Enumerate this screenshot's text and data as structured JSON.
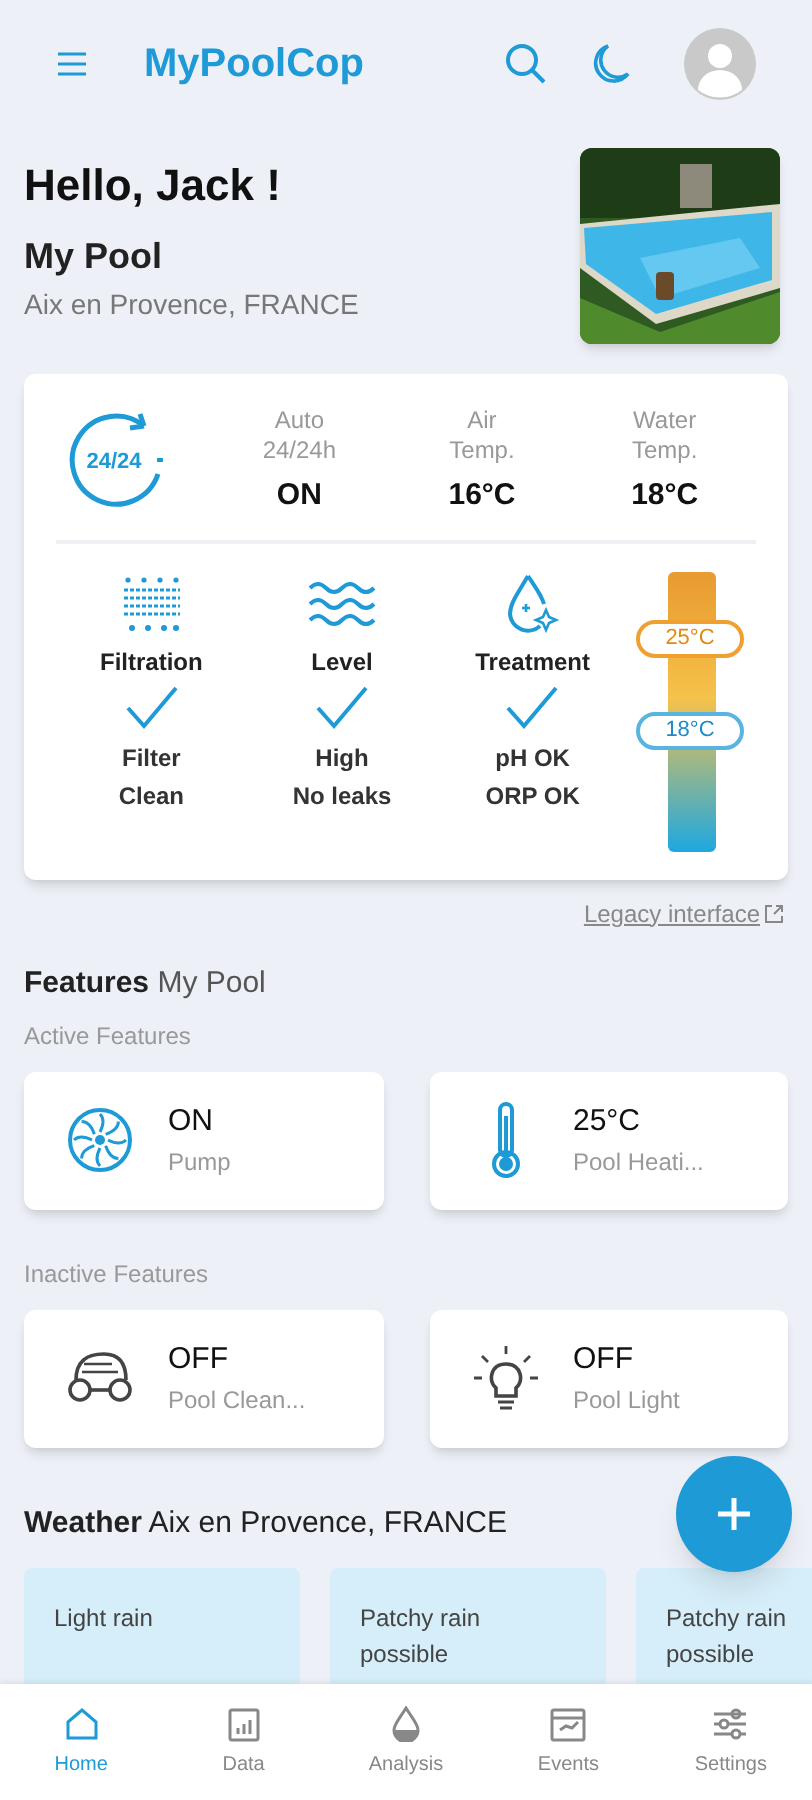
{
  "header": {
    "title": "MyPoolCop"
  },
  "greeting": "Hello, Jack !",
  "pool": {
    "name": "My Pool",
    "location": "Aix en Provence, FRANCE"
  },
  "summary": {
    "badge": "24/24",
    "stats": [
      {
        "label": "Auto\n24/24h",
        "value": "ON"
      },
      {
        "label": "Air\nTemp.",
        "value": "16°C"
      },
      {
        "label": "Water\nTemp.",
        "value": "18°C"
      }
    ],
    "checks": [
      {
        "kind": "filtration",
        "title": "Filtration",
        "checked": true,
        "status": "Filter\nClean"
      },
      {
        "kind": "level",
        "title": "Level",
        "checked": true,
        "status": "High\nNo leaks"
      },
      {
        "kind": "treatment",
        "title": "Treatment",
        "checked": true,
        "status": "pH OK\nORP OK"
      }
    ],
    "gauge": {
      "target": "25°C",
      "current": "18°C"
    }
  },
  "legacy_link": "Legacy interface",
  "features": {
    "title": "Features",
    "subtitle": "My Pool",
    "groups": [
      {
        "label": "Active Features",
        "items": [
          {
            "kind": "pump",
            "value": "ON",
            "name": "Pump"
          },
          {
            "kind": "heater",
            "value": "25°C",
            "name": "Pool Heati..."
          }
        ]
      },
      {
        "label": "Inactive Features",
        "items": [
          {
            "kind": "cleaner",
            "value": "OFF",
            "name": "Pool Clean..."
          },
          {
            "kind": "light",
            "value": "OFF",
            "name": "Pool Light"
          }
        ]
      }
    ]
  },
  "weather": {
    "title": "Weather",
    "location": "Aix en Provence, FRANCE",
    "cards": [
      "Light rain",
      "Patchy rain possible",
      "Patchy rain possible"
    ]
  },
  "nav": [
    {
      "kind": "home",
      "label": "Home",
      "selected": true
    },
    {
      "kind": "data",
      "label": "Data",
      "selected": false
    },
    {
      "kind": "analysis",
      "label": "Analysis",
      "selected": false
    },
    {
      "kind": "events",
      "label": "Events",
      "selected": false
    },
    {
      "kind": "settings",
      "label": "Settings",
      "selected": false
    }
  ]
}
